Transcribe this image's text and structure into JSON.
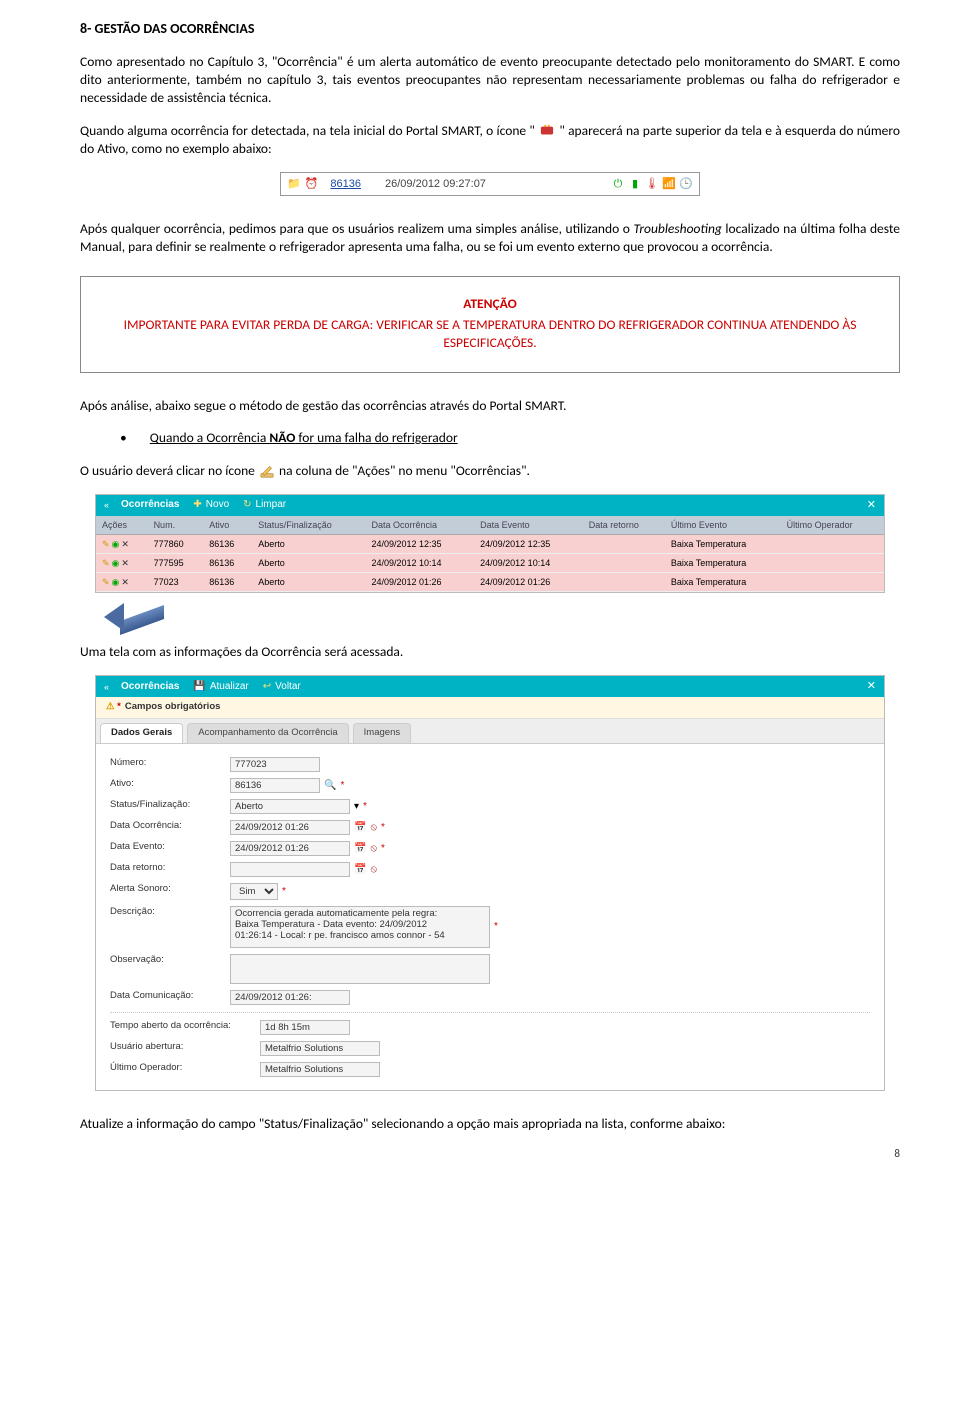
{
  "sectionTitle": "8-   GESTÃO DAS OCORRÊNCIAS",
  "p1": "Como apresentado no Capítulo 3, \"Ocorrência\" é um alerta automático de evento preocupante detectado pelo monitoramento do SMART. E como dito anteriormente, também no capítulo 3, tais eventos preocupantes não representam necessariamente problemas ou falha do refrigerador e necessidade de assistência técnica.",
  "p2a": "Quando alguma ocorrência for detectada, na tela inicial do Portal SMART, o ícone \"",
  "p2b": "\" aparecerá  na parte superior da tela e à esquerda do número do Ativo, como no exemplo abaixo:",
  "statusBar": {
    "ativo": "86136",
    "datetime": "26/09/2012 09:27:07"
  },
  "p3a": "Após qualquer ocorrência, pedimos para que os usuários realizem uma simples análise, utilizando o ",
  "p3Italic": "Troubleshooting",
  "p3b": " localizado na última folha deste Manual, para definir se realmente o refrigerador apresenta uma falha, ou se foi um evento externo que provocou a ocorrência.",
  "attention": {
    "title": "ATENÇÃO",
    "text": "IMPORTANTE PARA EVITAR PERDA DE CARGA: VERIFICAR SE A TEMPERATURA DENTRO DO REFRIGERADOR CONTINUA ATENDENDO ÀS ESPECIFICAÇÕES."
  },
  "p4": "Após análise, abaixo segue o método de gestão das ocorrências através do Portal SMART.",
  "bullet1a": "Quando a Ocorrência ",
  "bullet1Bold": "NÃO",
  "bullet1b": " for uma falha do refrigerador",
  "p5a": "O usuário deverá clicar no ícone ",
  "p5b": "  na coluna de \"Ações\" no menu \"Ocorrências\".",
  "panel1": {
    "title": "Ocorrências",
    "novo": "Novo",
    "limpar": "Limpar",
    "headers": [
      "Ações",
      "Num.",
      "Ativo",
      "Status/Finalização",
      "Data Ocorrência",
      "Data Evento",
      "Data retorno",
      "Último Evento",
      "Último Operador"
    ],
    "rows": [
      {
        "num": "777860",
        "ativo": "86136",
        "status": "Aberto",
        "dOco": "24/09/2012 12:35",
        "dEv": "24/09/2012 12:35",
        "dRet": "",
        "ultEv": "Baixa Temperatura",
        "ultOp": ""
      },
      {
        "num": "777595",
        "ativo": "86136",
        "status": "Aberto",
        "dOco": "24/09/2012 10:14",
        "dEv": "24/09/2012 10:14",
        "dRet": "",
        "ultEv": "Baixa Temperatura",
        "ultOp": ""
      },
      {
        "num": "77023",
        "ativo": "86136",
        "status": "Aberto",
        "dOco": "24/09/2012 01:26",
        "dEv": "24/09/2012 01:26",
        "dRet": "",
        "ultEv": "Baixa Temperatura",
        "ultOp": ""
      }
    ]
  },
  "p6": "Uma tela com as informações da Ocorrência será acessada.",
  "panel2": {
    "title": "Ocorrências",
    "atualizar": "Atualizar",
    "voltar": "Voltar",
    "reqLabel": "Campos obrigatórios",
    "tabs": [
      "Dados Gerais",
      "Acompanhamento da Ocorrência",
      "Imagens"
    ],
    "fields": {
      "numeroLabel": "Número:",
      "numero": "777023",
      "ativoLabel": "Ativo:",
      "ativo": "86136",
      "statusLabel": "Status/Finalização:",
      "status": "Aberto",
      "dataOcoLabel": "Data Ocorrência:",
      "dataOco": "24/09/2012 01:26",
      "dataEvLabel": "Data Evento:",
      "dataEv": "24/09/2012 01:26",
      "dataRetLabel": "Data retorno:",
      "dataRet": "",
      "alertaLabel": "Alerta Sonoro:",
      "alerta": "Sim",
      "descLabel": "Descrição:",
      "desc": "Ocorrencia gerada automaticamente pela regra:\nBaixa Temperatura - Data evento: 24/09/2012\n01:26:14 - Local: r pe. francisco amos connor - 54",
      "obsLabel": "Observação:",
      "obs": "",
      "dataComLabel": "Data Comunicação:",
      "dataCom": "24/09/2012 01:26:",
      "tempoLabel": "Tempo aberto da ocorrência:",
      "tempo": "1d 8h 15m",
      "usrAbLabel": "Usuário abertura:",
      "usrAb": "Metalfrio Solutions",
      "ultOpLabel": "Último Operador:",
      "ultOp": "Metalfrio Solutions"
    }
  },
  "p7": "Atualize a informação do campo \"Status/Finalização\" selecionando a opção mais apropriada na lista, conforme abaixo:",
  "pageNum": "8"
}
